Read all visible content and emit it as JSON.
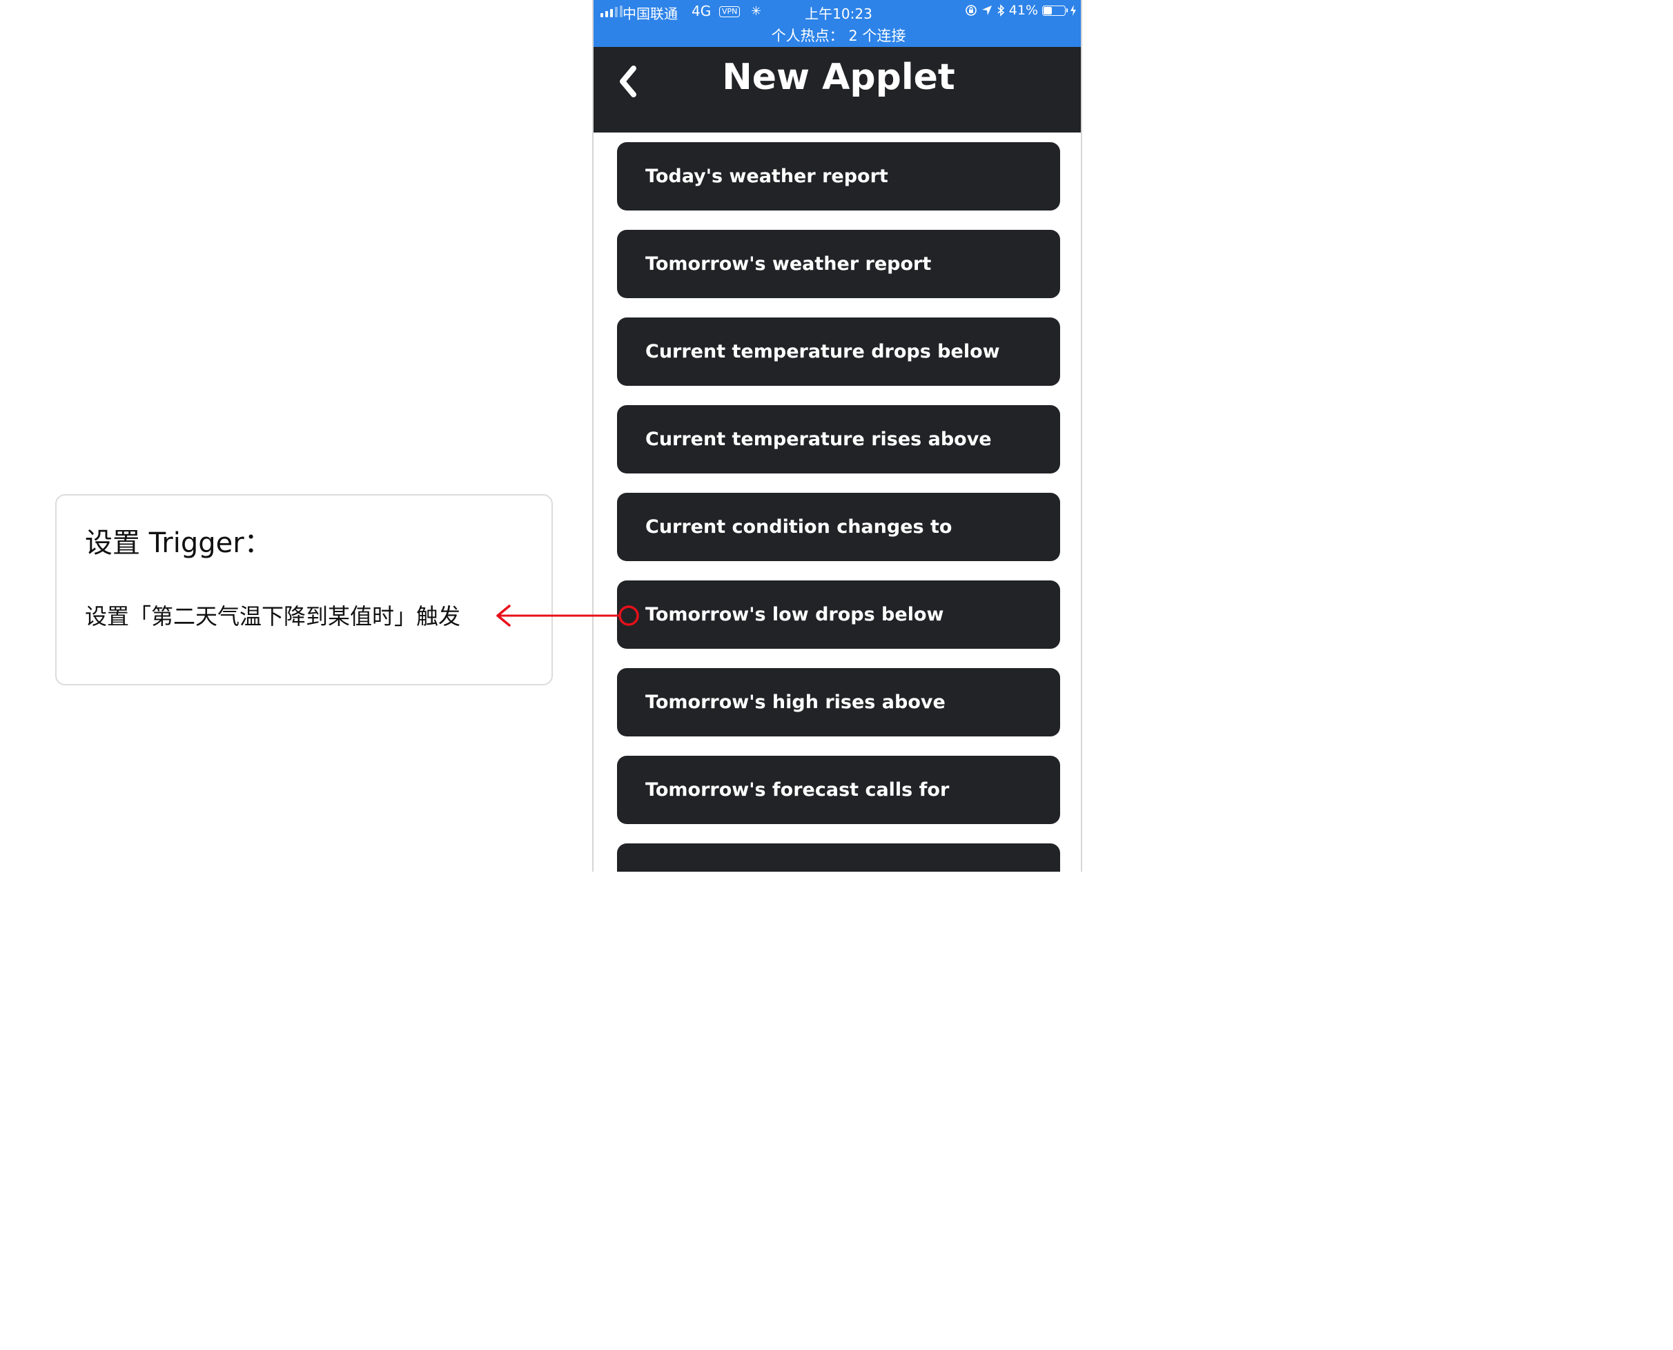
{
  "annotation": {
    "title": "设置 Trigger：",
    "description": "设置「第二天气温下降到某值时」触发",
    "highlight_color": "#e8101a"
  },
  "status_bar": {
    "carrier": "中国联通",
    "network": "4G",
    "vpn": "VPN",
    "time": "上午10:23",
    "battery": "41%",
    "battery_level": 0.41,
    "hotspot": "个人热点：  2 个连接",
    "background": "#2d83e8"
  },
  "nav": {
    "title": "New Applet",
    "back_icon": "chevron-left-icon",
    "background": "#222326"
  },
  "triggers": [
    {
      "label": "Today's weather report"
    },
    {
      "label": "Tomorrow's weather report"
    },
    {
      "label": "Current temperature drops below"
    },
    {
      "label": "Current temperature rises above"
    },
    {
      "label": "Current condition changes to"
    },
    {
      "label": "Tomorrow's low drops below",
      "highlighted": true
    },
    {
      "label": "Tomorrow's high rises above"
    },
    {
      "label": "Tomorrow's forecast calls for"
    },
    {
      "label": ""
    }
  ]
}
